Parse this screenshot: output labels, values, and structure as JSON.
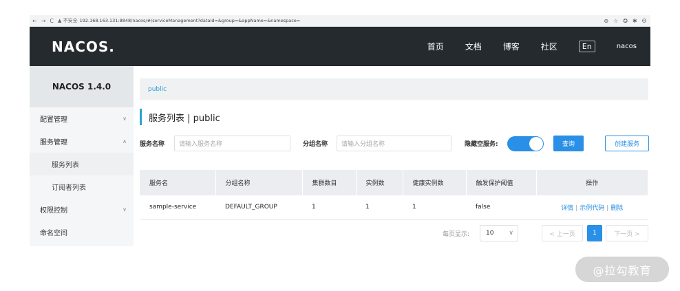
{
  "browser": {
    "nav": [
      "←",
      "→",
      "C"
    ],
    "security": "▲ 不安全",
    "url": "192.168.163.131:8848/nacos/#/serviceManagement?dataId=&group=&appName=&namespace=",
    "tools": [
      "⊕",
      "☆",
      "✪",
      "✱",
      "Θ"
    ]
  },
  "header": {
    "logo": "NACOS.",
    "nav": [
      "首页",
      "文档",
      "博客",
      "社区"
    ],
    "lang": "En",
    "user": "nacos"
  },
  "sidebar": {
    "title": "NACOS 1.4.0",
    "items": [
      {
        "label": "配置管理",
        "arrow": "∨"
      },
      {
        "label": "服务管理",
        "arrow": "∧"
      },
      {
        "label": "服务列表"
      },
      {
        "label": "订阅者列表"
      },
      {
        "label": "权限控制",
        "arrow": "∨"
      },
      {
        "label": "命名空间"
      }
    ]
  },
  "breadcrumb": "public",
  "page_title": "服务列表 | public",
  "filters": {
    "service_label": "服务名称",
    "service_placeholder": "请输入服务名称",
    "group_label": "分组名称",
    "group_placeholder": "请输入分组名称",
    "hide_empty_label": "隐藏空服务:",
    "hide_empty": true,
    "query": "查询",
    "create": "创建服务"
  },
  "table": {
    "headers": [
      "服务名",
      "分组名称",
      "集群数目",
      "实例数",
      "健康实例数",
      "触发保护阈值",
      "操作"
    ],
    "rows": [
      {
        "service": "sample-service",
        "group": "DEFAULT_GROUP",
        "clusters": "1",
        "instances": "1",
        "healthy": "1",
        "threshold": "false"
      }
    ],
    "ops": [
      "详情",
      "示例代码",
      "删除"
    ],
    "sep": "|"
  },
  "pager": {
    "label": "每页显示:",
    "size": "10",
    "prev": "< 上一页",
    "current": "1",
    "next": "下一页 >"
  },
  "watermark": "@拉勾教育",
  "colors": {
    "accent": "#2a8fe6",
    "header_bg": "#252a2f",
    "breadcrumb": "#2aa0d8"
  }
}
